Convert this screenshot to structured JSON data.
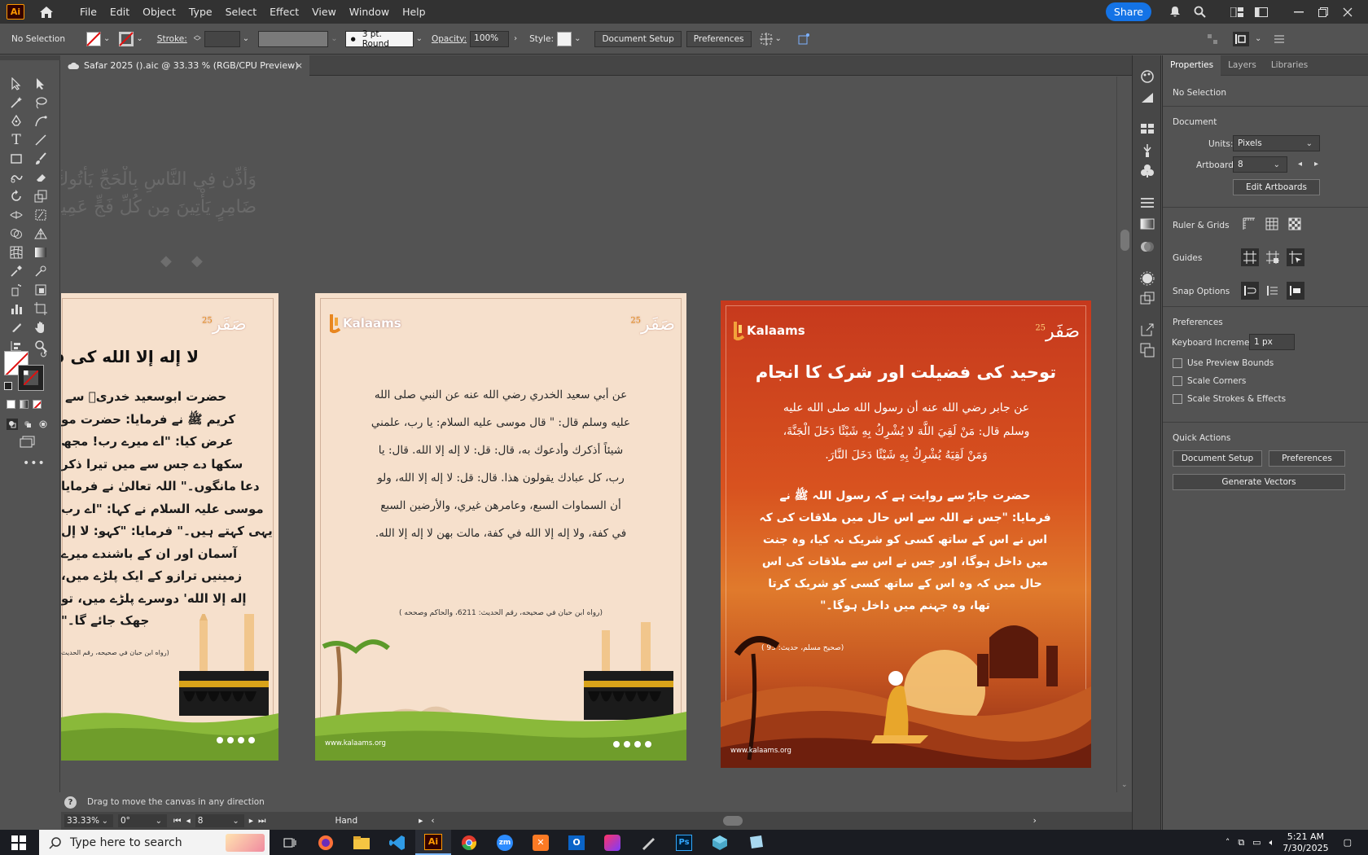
{
  "menubar": {
    "app_abbr": "Ai",
    "items": [
      "File",
      "Edit",
      "Object",
      "Type",
      "Select",
      "Effect",
      "View",
      "Window",
      "Help"
    ],
    "share_label": "Share"
  },
  "control": {
    "selection": "No Selection",
    "stroke_label": "Stroke:",
    "brush_value": "3 pt. Round",
    "opacity_label": "Opacity:",
    "opacity_value": "100%",
    "style_label": "Style:",
    "doc_setup": "Document Setup",
    "preferences": "Preferences"
  },
  "tab": {
    "title": "Safar 2025 ().aic @ 33.33 % (RGB/CPU Preview)",
    "close": "×"
  },
  "artboard1": {
    "logo_num": "25",
    "title": "لا إله إلا الله کی ف",
    "lines": [
      "حضرت ابوسعید خدریؓ سے",
      "کریم ﷺ نے فرمایا: حضرت مو",
      "عرض کیا: \"اے میرے رب! مجھ",
      "سکھا دے جس سے میں تیرا ذکر",
      "دعا مانگوں۔\" اللہ تعالیٰ نے فرمایا",
      "موسی علیہ السلام نے کہا: \"اے رب",
      "یہی کہتے ہیں۔\" فرمایا: \"کہو: لا إل",
      "آسمان اور ان کے باشندے میرے",
      "زمینیں ترازو کے ایک پلڑے میں،",
      "إله إلا الله' دوسرے پلڑے میں، تو",
      "جھک جائے گا۔\""
    ],
    "source": "(رواه ابن حبان في صحيحه، رقم الحديث"
  },
  "artboard2": {
    "brand": "Kalaams",
    "logo_num": "25",
    "hadith": [
      "عن أبي سعيد الخدري رضي الله عنه عن النبي صلى الله",
      "عليه وسلم قال: \" قال موسى عليه السلام: يا رب، علمني",
      "شيئاً أذكرك وأدعوك به، قال: قل: لا إله إلا الله. قال: يا",
      "رب، كل عبادك يقولون هذا. قال: قل: لا إله إلا الله، ولو",
      "أن السماوات السبع، وعامرهن غيري، والأرضين السبع",
      "في كفة، ولا إله إلا الله في كفة، مالت بهن لا إله إلا الله."
    ],
    "source": "(رواه ابن حبان في صحيحه، رقم الحديث: 6211، والحاكم وصححه )",
    "website": "www.kalaams.org"
  },
  "artboard3": {
    "brand": "Kalaams",
    "logo_num": "25",
    "title": "توحید کی فضیلت اور شرک کا انجام",
    "arabic": [
      "عن جابر رضي الله عنه أن رسول الله صلى الله عليه",
      "وسلم قال: مَنْ لَقِيَ اللَّهَ لا يُشْرِكُ بِهِ شَيْئًا دَخَلَ الْجَنَّةَ،",
      "وَمَنْ لَقِيَهُ يُشْرِكُ بِهِ شَيْئًا دَخَلَ النَّارَ."
    ],
    "urdu": [
      "حضرت جابرؓ سے روایت ہے کہ رسول اللہ ﷺ نے",
      "فرمایا: \"جس نے اللہ سے اس حال میں ملاقات کی کہ",
      "اس نے اس کے ساتھ کسی کو شریک نہ کیا، وہ جنت",
      "میں داخل ہوگا، اور جس نے اس سے ملاقات کی اس",
      "حال میں کہ وہ اس کے ساتھ کسی کو شریک کرتا",
      "تھا، وہ جہنم میں داخل ہوگا۔\""
    ],
    "source": "(صحیح مسلم، حدیث: 93 )",
    "website": "www.kalaams.org"
  },
  "ghost_text": [
    "وَأَذِّن فِي النَّاسِ بِالْحَجِّ يَأْتُوكَ رِجَالًا وَعَلَىٰ",
    "ضَامِرٍ يَأْتِينَ مِن كُلِّ فَجٍّ عَمِيقٍ"
  ],
  "status": {
    "hint": "Drag to move the canvas in any direction",
    "zoom": "33.33%",
    "rotation": "0°",
    "artboard": "8",
    "tool": "Hand"
  },
  "properties": {
    "tabs": [
      "Properties",
      "Layers",
      "Libraries"
    ],
    "no_selection": "No Selection",
    "document": "Document",
    "units_label": "Units:",
    "units_value": "Pixels",
    "artboard_label": "Artboard:",
    "artboard_value": "8",
    "edit_artboards": "Edit Artboards",
    "ruler_grids": "Ruler & Grids",
    "guides": "Guides",
    "snap_options": "Snap Options",
    "preferences": "Preferences",
    "keyboard_inc_label": "Keyboard Increment:",
    "keyboard_inc_value": "1 px",
    "use_preview_bounds": "Use Preview Bounds",
    "scale_corners": "Scale Corners",
    "scale_strokes": "Scale Strokes & Effects",
    "quick_actions": "Quick Actions",
    "document_setup": "Document Setup",
    "prefs_button": "Preferences",
    "generate_vectors": "Generate Vectors"
  },
  "taskbar": {
    "search_placeholder": "Type here to search",
    "time": "5:21 AM",
    "date": "7/30/2025"
  },
  "colors": {
    "accent": "#1473e6",
    "artboard_bg": "#f6e0cc",
    "orange": "#d8521f"
  }
}
